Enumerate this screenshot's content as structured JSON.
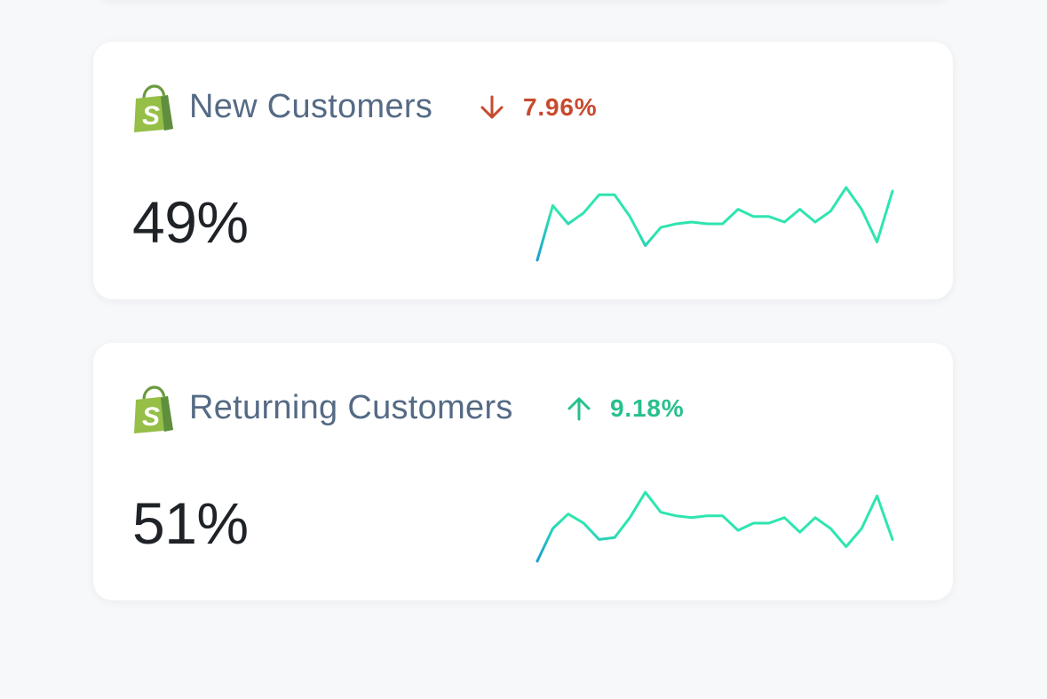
{
  "cards": [
    {
      "title": "New Customers",
      "change": {
        "direction": "down",
        "percent": "7.96%",
        "color": "#c84a2e"
      },
      "value": "49%",
      "icon": "shopify-bag-icon",
      "sparkline": [
        1,
        16,
        11,
        14,
        19,
        19,
        13,
        5,
        10,
        11,
        11.5,
        11,
        11,
        15,
        13,
        13,
        11.5,
        15,
        11.5,
        14.5,
        21,
        15,
        6,
        20
      ]
    },
    {
      "title": "Returning Customers",
      "change": {
        "direction": "up",
        "percent": "9.18%",
        "color": "#27c08c"
      },
      "value": "51%",
      "icon": "shopify-bag-icon",
      "sparkline": [
        1,
        10,
        14,
        11.5,
        7,
        7.5,
        13,
        20,
        14.5,
        13.5,
        13,
        13.5,
        13.5,
        9.5,
        11.5,
        11.5,
        13,
        9,
        13,
        10,
        5,
        10,
        19,
        7
      ]
    }
  ],
  "colors": {
    "background": "#f7f8fa",
    "card": "#ffffff",
    "title": "#556a85",
    "value": "#1f2327",
    "sparkline_start": "#1a9fd0",
    "sparkline_end": "#2ee5b0",
    "shopify_green": "#95bf47",
    "shopify_dark": "#5e8e3e"
  }
}
